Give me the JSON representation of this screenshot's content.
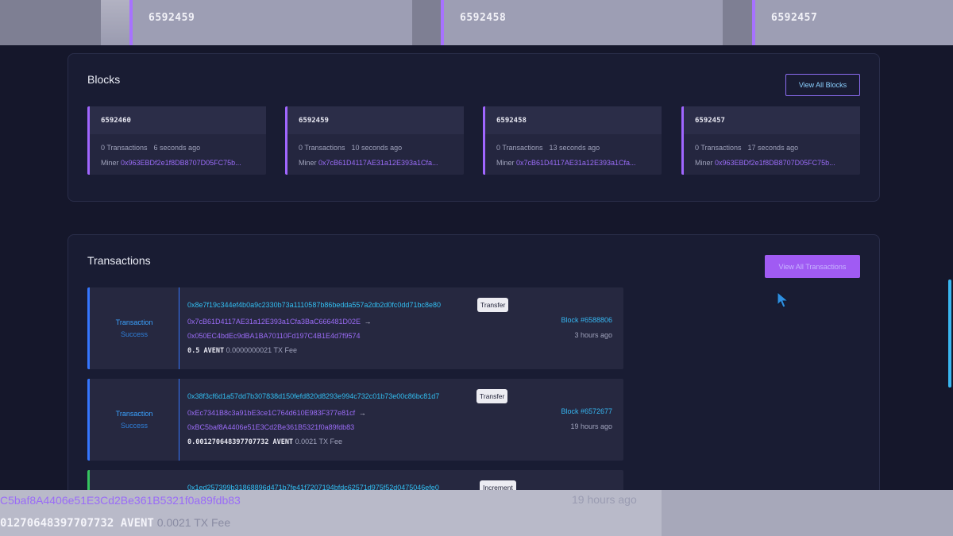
{
  "top_strip": {
    "numbers": [
      "6592459",
      "6592458",
      "6592457"
    ]
  },
  "blocks": {
    "title": "Blocks",
    "view_all_label": "View All Blocks",
    "items": [
      {
        "number": "6592460",
        "transactions": "0 Transactions",
        "ago": "6 seconds ago",
        "miner_label": "Miner",
        "miner": "0x963EBDf2e1f8DB8707D05FC75b..."
      },
      {
        "number": "6592459",
        "transactions": "0 Transactions",
        "ago": "10 seconds ago",
        "miner_label": "Miner",
        "miner": "0x7cB61D4117AE31a12E393a1Cfa..."
      },
      {
        "number": "6592458",
        "transactions": "0 Transactions",
        "ago": "13 seconds ago",
        "miner_label": "Miner",
        "miner": "0x7cB61D4117AE31a12E393a1Cfa..."
      },
      {
        "number": "6592457",
        "transactions": "0 Transactions",
        "ago": "17 seconds ago",
        "miner_label": "Miner",
        "miner": "0x963EBDf2e1f8DB8707D05FC75b..."
      }
    ]
  },
  "transactions": {
    "title": "Transactions",
    "view_all_label": "View All Transactions",
    "items": [
      {
        "status_1": "Transaction",
        "status_2": "Success",
        "hash": "0x8e7f19c344ef4b0a9c2330b73a1110587b86bedda557a2db2d0fc0dd71bc8e80",
        "type": "Transfer",
        "from": "0x7cB61D4117AE31a12E393a1Cfa3BaC666481D02E",
        "arrow": "→",
        "to": "0x050EC4bdEc9dBA1BA70110Fd197C4B1E4d7f9574",
        "amount": "0.5 AVENT",
        "fee": "0.0000000021 TX Fee",
        "block": "Block #6588806",
        "time": "3 hours ago"
      },
      {
        "status_1": "Transaction",
        "status_2": "Success",
        "hash": "0x38f3cf6d1a57dd7b307838d150fefd820d8293e994c732c01b73e00c86bc81d7",
        "type": "Transfer",
        "from": "0xEc7341B8c3a91bE3ce1C764d610E983F377e81cf",
        "arrow": "→",
        "to": "0xBC5baf8A4406e51E3Cd2Be361B5321f0a89fdb83",
        "amount": "0.001270648397707732 AVENT",
        "fee": "0.0021 TX Fee",
        "block": "Block #6572677",
        "time": "19 hours ago"
      },
      {
        "hash": "0x1ed257399b31868896d471b7fe41f7207194bfdc62571d975f52d0475046efe0",
        "type": "Increment"
      }
    ]
  },
  "bottom_strip": {
    "address": "C5baf8A4406e51E3Cd2Be361B5321f0a89fdb83",
    "amount": "01270648397707732 AVENT",
    "fee": "0.0021 TX Fee",
    "time": "19 hours ago"
  },
  "colors": {
    "background": "#15172b",
    "accent_purple": "#a05bf3",
    "link_cyan": "#32bff2",
    "status_blue": "#3576ff",
    "status_green": "#35c45f"
  }
}
